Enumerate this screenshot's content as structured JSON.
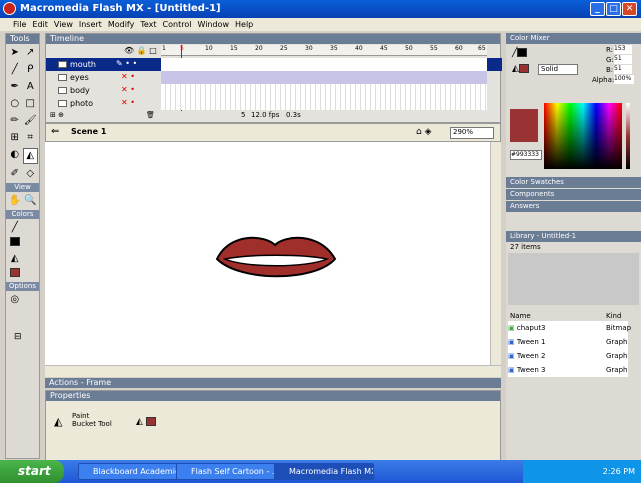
{
  "window": {
    "title": "Macromedia Flash MX - [Untitled-1]"
  },
  "menu": [
    "File",
    "Edit",
    "View",
    "Insert",
    "Modify",
    "Text",
    "Control",
    "Window",
    "Help"
  ],
  "tools": {
    "header": "Tools",
    "sections": [
      "View",
      "Colors",
      "Options"
    ]
  },
  "timeline": {
    "header": "Timeline",
    "layers": [
      "mouth",
      "eyes",
      "body",
      "photo"
    ],
    "ruler": [
      "1",
      "5",
      "10",
      "15",
      "20",
      "25",
      "30",
      "35",
      "40",
      "45",
      "50",
      "55",
      "60",
      "65"
    ],
    "status": {
      "frame": "5",
      "fps": "12.0 fps",
      "time": "0.3s"
    }
  },
  "stage": {
    "scene": "Scene 1",
    "zoom": "290%"
  },
  "panels": {
    "actions": "Actions - Frame",
    "properties": "Properties",
    "tool_name": "Paint Bucket Tool"
  },
  "color_mixer": {
    "title": "Color Mixer",
    "r_label": "R:",
    "r": "153",
    "g_label": "G:",
    "g": "51",
    "b_label": "B:",
    "b": "51",
    "alpha_label": "Alpha:",
    "alpha": "100%",
    "fill_type": "Solid",
    "hex": "#993333"
  },
  "right_panels": [
    "Color Swatches",
    "Components",
    "Answers"
  ],
  "library": {
    "title": "Library - Untitled-1",
    "count": "27 items",
    "col_name": "Name",
    "col_kind": "Kind",
    "items": [
      {
        "name": "chaput3",
        "kind": "Bitmap"
      },
      {
        "name": "Tween 1",
        "kind": "Graph"
      },
      {
        "name": "Tween 2",
        "kind": "Graph"
      },
      {
        "name": "Tween 3",
        "kind": "Graph"
      }
    ]
  },
  "taskbar": {
    "start": "start",
    "tasks": [
      "Blackboard Academic ...",
      "Flash Self Cartoon - ...",
      "Macromedia Flash MX..."
    ],
    "clock": "2:26 PM"
  },
  "colors": {
    "fill": "#993333",
    "lips": "#a02e2b"
  }
}
